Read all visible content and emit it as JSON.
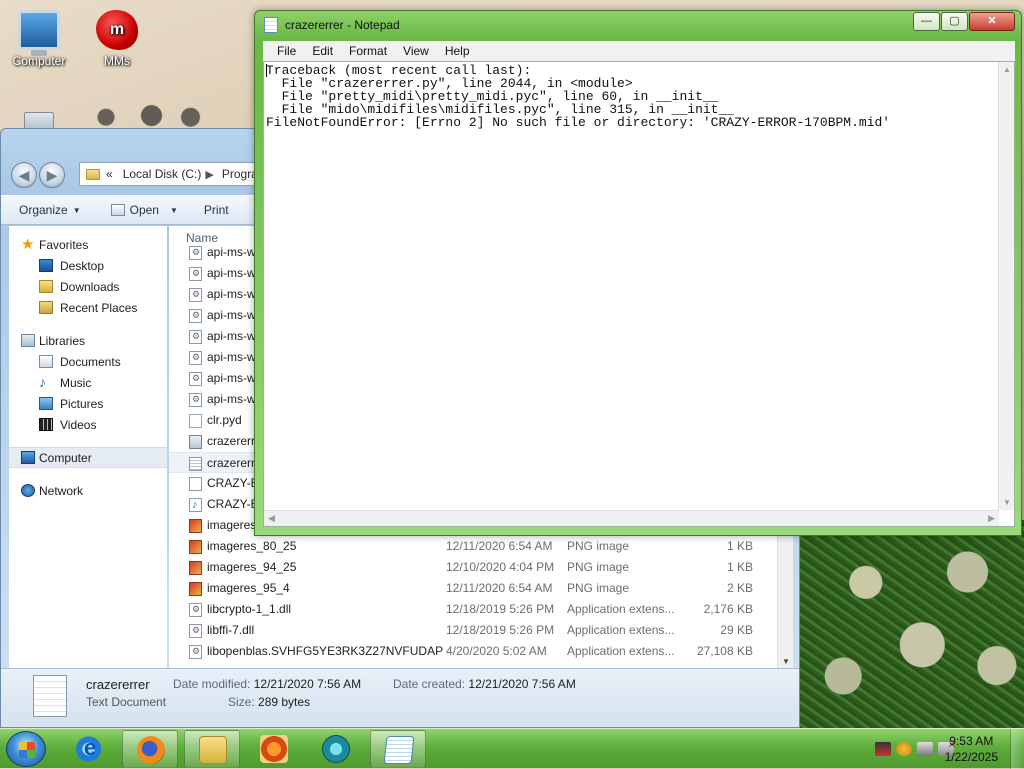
{
  "desktop": {
    "icons": [
      {
        "label": "Computer",
        "icon": "computer-icon"
      },
      {
        "label": "MMs",
        "icon": "mms-candy-icon"
      },
      {
        "label": "",
        "icon": "recycle-bin-icon"
      }
    ]
  },
  "explorer": {
    "address": {
      "prefix": "«",
      "crumbs": [
        "Local Disk (C:)",
        "Progra"
      ]
    },
    "toolbar": {
      "organize": "Organize",
      "open": "Open",
      "print": "Print"
    },
    "nav": {
      "favorites": "Favorites",
      "desktop": "Desktop",
      "downloads": "Downloads",
      "recent_places": "Recent Places",
      "libraries": "Libraries",
      "documents": "Documents",
      "music": "Music",
      "pictures": "Pictures",
      "videos": "Videos",
      "computer": "Computer",
      "network": "Network"
    },
    "columns": {
      "name": "Name"
    },
    "files": [
      {
        "name": "api-ms-w",
        "date": "",
        "type": "",
        "size": "",
        "icon": "gear-file-icon"
      },
      {
        "name": "api-ms-w",
        "date": "",
        "type": "",
        "size": "",
        "icon": "gear-file-icon"
      },
      {
        "name": "api-ms-w",
        "date": "",
        "type": "",
        "size": "",
        "icon": "gear-file-icon"
      },
      {
        "name": "api-ms-w",
        "date": "",
        "type": "",
        "size": "",
        "icon": "gear-file-icon"
      },
      {
        "name": "api-ms-w",
        "date": "",
        "type": "",
        "size": "",
        "icon": "gear-file-icon"
      },
      {
        "name": "api-ms-w",
        "date": "",
        "type": "",
        "size": "",
        "icon": "gear-file-icon"
      },
      {
        "name": "api-ms-w",
        "date": "",
        "type": "",
        "size": "",
        "icon": "gear-file-icon"
      },
      {
        "name": "api-ms-w",
        "date": "",
        "type": "",
        "size": "",
        "icon": "gear-file-icon"
      },
      {
        "name": "clr.pyd",
        "date": "",
        "type": "",
        "size": "",
        "icon": "blank-file-icon"
      },
      {
        "name": "crazererre",
        "date": "",
        "type": "",
        "size": "",
        "icon": "exe-file-icon"
      },
      {
        "name": "crazererre",
        "date": "",
        "type": "",
        "size": "",
        "icon": "text-file-icon",
        "selected": true
      },
      {
        "name": "CRAZY-E",
        "date": "",
        "type": "",
        "size": "",
        "icon": "wav-file-icon"
      },
      {
        "name": "CRAZY-E",
        "date": "",
        "type": "",
        "size": "",
        "icon": "midi-file-icon"
      },
      {
        "name": "imageres_77_25",
        "date": "12/11/2020 6:53 AM",
        "type": "PNG image",
        "size": "1 KB",
        "icon": "png-file-icon"
      },
      {
        "name": "imageres_80_25",
        "date": "12/11/2020 6:54 AM",
        "type": "PNG image",
        "size": "1 KB",
        "icon": "png-file-icon"
      },
      {
        "name": "imageres_94_25",
        "date": "12/10/2020 4:04 PM",
        "type": "PNG image",
        "size": "1 KB",
        "icon": "png-file-icon"
      },
      {
        "name": "imageres_95_4",
        "date": "12/11/2020 6:54 AM",
        "type": "PNG image",
        "size": "2 KB",
        "icon": "png-file-icon"
      },
      {
        "name": "libcrypto-1_1.dll",
        "date": "12/18/2019 5:26 PM",
        "type": "Application extens...",
        "size": "2,176 KB",
        "icon": "dll-file-icon"
      },
      {
        "name": "libffi-7.dll",
        "date": "12/18/2019 5:26 PM",
        "type": "Application extens...",
        "size": "29 KB",
        "icon": "dll-file-icon"
      },
      {
        "name": "libopenblas.SVHFG5YE3RK3Z27NVFUDAP",
        "date": "4/20/2020 5:02 AM",
        "type": "Application extens...",
        "size": "27,108 KB",
        "icon": "dll-file-icon"
      }
    ],
    "details": {
      "name": "crazererrer",
      "type": "Text Document",
      "modified_label": "Date modified:",
      "modified": "12/21/2020 7:56 AM",
      "created_label": "Date created:",
      "created": "12/21/2020 7:56 AM",
      "size_label": "Size:",
      "size": "289 bytes"
    }
  },
  "notepad": {
    "title": "crazererrer - Notepad",
    "menu": [
      "File",
      "Edit",
      "Format",
      "View",
      "Help"
    ],
    "content": "Traceback (most recent call last):\n  File \"crazererrer.py\", line 2044, in <module>\n  File \"pretty_midi\\pretty_midi.pyc\", line 60, in __init__\n  File \"mido\\midifiles\\midifiles.pyc\", line 315, in __init__\nFileNotFoundError: [Errno 2] No such file or directory: 'CRAZY-ERROR-170BPM.mid'"
  },
  "taskbar": {
    "apps": [
      "internet-explorer",
      "firefox",
      "windows-explorer",
      "media-player",
      "media-center",
      "notepad"
    ],
    "clock": {
      "time": "9:53 AM",
      "date": "1/22/2025"
    }
  },
  "colors": {
    "taskbar": "#5fae3c",
    "notepad_frame": "#6ab845",
    "explorer_frame": "#a8c8e6"
  }
}
